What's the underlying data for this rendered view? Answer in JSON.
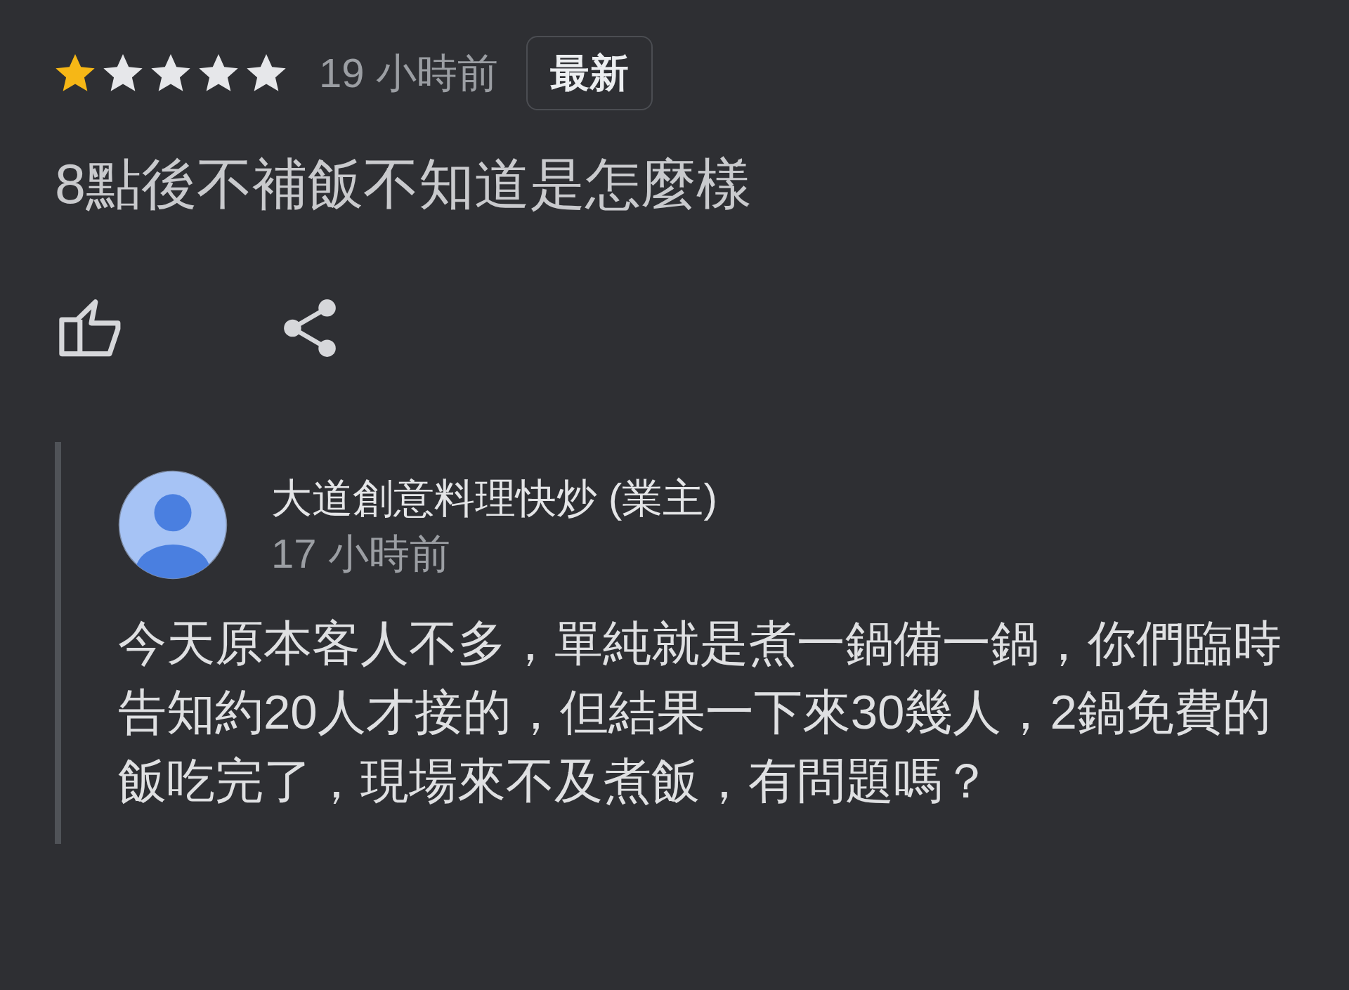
{
  "review": {
    "stars": 1,
    "time": "19 小時前",
    "badge": "最新",
    "text": "8點後不補飯不知道是怎麼樣"
  },
  "reply": {
    "author": "大道創意料理快炒 (業主)",
    "time": "17 小時前",
    "text": "今天原本客人不多，單純就是煮一鍋備一鍋，你們臨時告知約20人才接的，但結果一下來30幾人，2鍋免費的飯吃完了，現場來不及煮飯，有問題嗎？"
  }
}
